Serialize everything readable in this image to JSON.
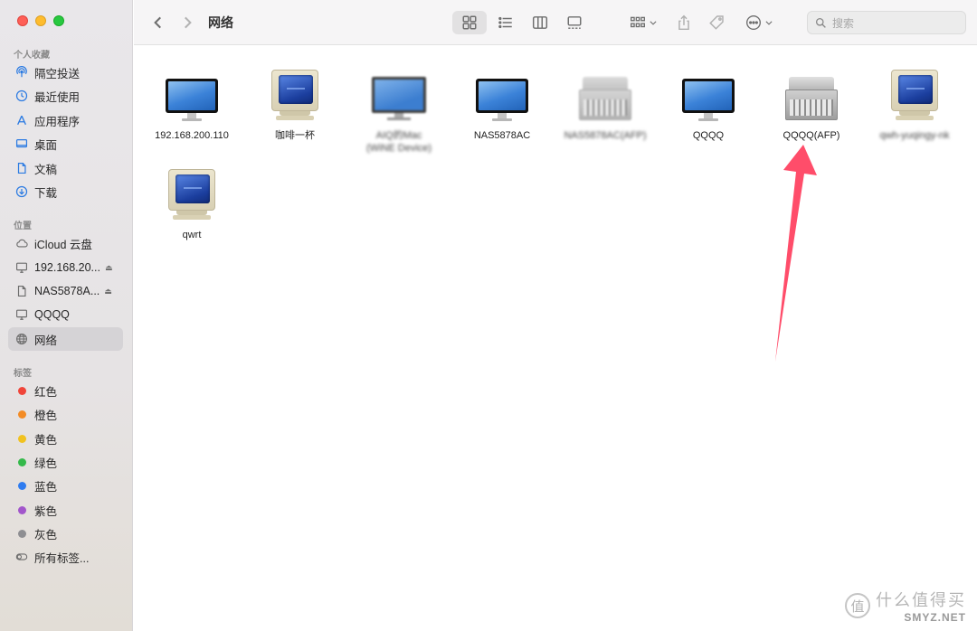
{
  "window": {
    "title": "网络"
  },
  "sidebar": {
    "favorites_title": "个人收藏",
    "favorites": [
      {
        "label": "隔空投送",
        "icon": "airdrop-icon"
      },
      {
        "label": "最近使用",
        "icon": "clock-icon"
      },
      {
        "label": "应用程序",
        "icon": "applications-icon"
      },
      {
        "label": "桌面",
        "icon": "desktop-icon"
      },
      {
        "label": "文稿",
        "icon": "document-icon"
      },
      {
        "label": "下载",
        "icon": "download-icon"
      }
    ],
    "locations_title": "位置",
    "locations": [
      {
        "label": "iCloud 云盘",
        "icon": "cloud-icon"
      },
      {
        "label": "192.168.20...",
        "icon": "monitor-icon",
        "eject": "⏏"
      },
      {
        "label": "NAS5878A...",
        "icon": "document-icon",
        "eject": "⏏"
      },
      {
        "label": "QQQQ",
        "icon": "monitor-icon"
      },
      {
        "label": "网络",
        "icon": "globe-icon",
        "selected": true
      }
    ],
    "tags_title": "标签",
    "tags": [
      {
        "label": "红色",
        "color": "#f0453a"
      },
      {
        "label": "橙色",
        "color": "#f38b25"
      },
      {
        "label": "黄色",
        "color": "#f1c21f"
      },
      {
        "label": "绿色",
        "color": "#34b94a"
      },
      {
        "label": "蓝色",
        "color": "#2f7cf0"
      },
      {
        "label": "紫色",
        "color": "#a256cb"
      },
      {
        "label": "灰色",
        "color": "#8e8e92"
      },
      {
        "label": "所有标签...",
        "icon": "all-tags-icon"
      }
    ]
  },
  "toolbar": {
    "search_placeholder": "搜索"
  },
  "items": [
    {
      "label": "192.168.200.110",
      "icon": "imac"
    },
    {
      "label": "咖啡一杯",
      "icon": "crt"
    },
    {
      "label": "AIQ的Mac (WiNE Device)",
      "icon": "pcmon",
      "blurred": true
    },
    {
      "label": "NAS5878AC",
      "icon": "imac"
    },
    {
      "label": "NAS5878AC(AFP)",
      "icon": "server-gray",
      "blurred": true
    },
    {
      "label": "QQQQ",
      "icon": "imac"
    },
    {
      "label": "QQQQ(AFP)",
      "icon": "server"
    },
    {
      "label": "qwh-yuqingy-nk",
      "icon": "crt",
      "blurred": true
    },
    {
      "label": "qwrt",
      "icon": "crt"
    }
  ],
  "colors": {
    "annotation_arrow": "#ff4d6a"
  },
  "watermark": {
    "cn": "什么值得买",
    "en": "SMYZ.NET",
    "logo": "值"
  }
}
